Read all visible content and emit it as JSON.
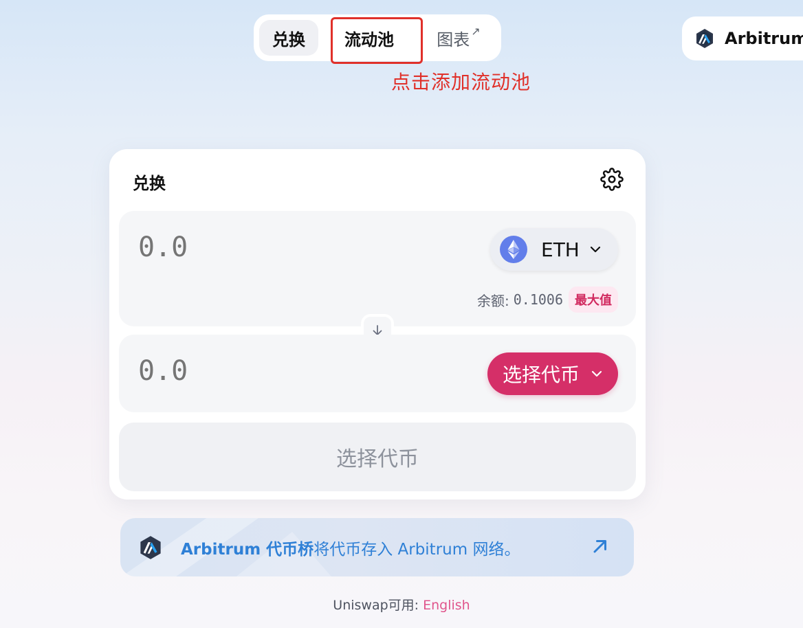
{
  "nav": {
    "tabs": [
      {
        "label": "兑换",
        "active": true
      },
      {
        "label": "流动池",
        "highlighted": true
      },
      {
        "label": "图表",
        "external_marker": "↗"
      }
    ]
  },
  "annotation": "点击添加流动池",
  "network": {
    "label": "Arbitrum",
    "icon": "arbitrum-logo-icon"
  },
  "swap": {
    "title": "兑换",
    "settings_icon": "gear-icon",
    "input": {
      "amount_placeholder": "0.0",
      "token_symbol": "ETH",
      "token_icon": "ethereum-logo-icon",
      "balance_label": "余额:",
      "balance_value": "0.1006",
      "max_label": "最大值"
    },
    "switch_icon": "arrow-down-icon",
    "output": {
      "amount_placeholder": "0.0",
      "select_token_label": "选择代币"
    },
    "action_label": "选择代币"
  },
  "bridge": {
    "title": "Arbitrum 代币桥",
    "description": "将代币存入 Arbitrum 网络。",
    "icon": "arbitrum-logo-icon",
    "arrow_icon": "arrow-up-right-icon"
  },
  "footer": {
    "prefix": "Uniswap可用:",
    "language": "English"
  },
  "colors": {
    "accent_pink": "#d52f68",
    "annotation_red": "#e0302a",
    "bridge_blue": "#2f80d6",
    "eth_purple": "#627eea"
  }
}
